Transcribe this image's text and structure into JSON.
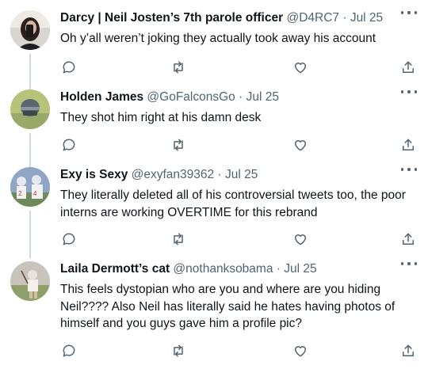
{
  "tweets": [
    {
      "name": "Darcy | Neil Josten’s 7th parole officer",
      "handle": "@D4RC7",
      "separator": "·",
      "time": "Jul 25",
      "text": "Oh y’all weren’t joking they actually took away his account"
    },
    {
      "name": "Holden James",
      "handle": "@GoFalconsGo",
      "separator": "·",
      "time": "Jul 25",
      "text": "They shot him right at his damn desk"
    },
    {
      "name": "Exy is Sexy",
      "handle": "@exyfan39362",
      "separator": "·",
      "time": "Jul 25",
      "text": "They literally deleted all of his controversial tweets too, the poor interns are working OVERTIME for this rebrand"
    },
    {
      "name": "Laila Dermott’s cat",
      "handle": "@nothanksobama",
      "separator": "·",
      "time": "Jul 25",
      "text": "This feels dystopian who are you and where are you hiding Neil???? Also Neil has literally said he hates having photos of himself and you guys gave him a profile pic?"
    }
  ],
  "icons": {
    "reply": "reply-icon",
    "retweet": "retweet-icon",
    "like": "like-icon",
    "share": "share-icon",
    "more": "more-icon"
  },
  "colors": {
    "text": "#0f1419",
    "secondary": "#536471",
    "thread_line": "#cfd9de",
    "background": "#ffffff"
  }
}
